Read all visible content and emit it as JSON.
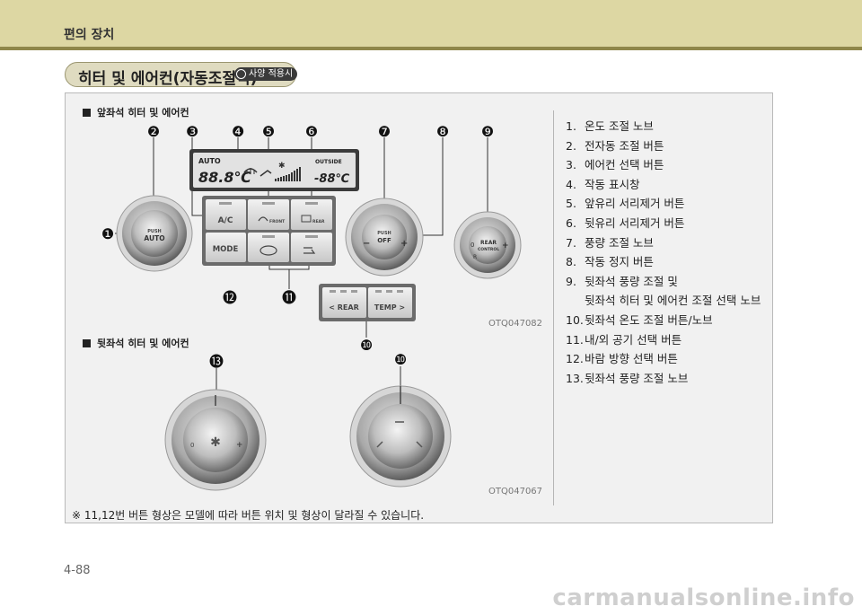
{
  "header": {
    "section_title": "편의 장치"
  },
  "title_pill": {
    "title": "히터 및 에어컨(자동조절식)",
    "badge": "사양 적용시"
  },
  "front": {
    "heading": "앞좌석 히터 및 에어컨",
    "image_code": "OTQ047082",
    "display": {
      "auto": "AUTO",
      "outside": "OUTSIDE",
      "temp": "88.8℃",
      "outside_temp": "-88℃"
    },
    "buttons": {
      "ac": "A/C",
      "front": "FRONT",
      "rear": "REAR",
      "mode": "MODE",
      "rear_ctrl": "< REAR",
      "temp_ctrl": "TEMP >"
    },
    "knobs": {
      "left_top": "PUSH",
      "left_bottom": "AUTO",
      "mid_top": "PUSH",
      "mid_bottom": "OFF",
      "right_line1": "REAR",
      "right_line2": "CONTROL",
      "right_zero": "0",
      "right_r": "R"
    }
  },
  "rear": {
    "heading": "뒷좌석 히터 및 에어컨",
    "image_code": "OTQ047067"
  },
  "callouts": [
    "❶",
    "❷",
    "❸",
    "❹",
    "❺",
    "❻",
    "❼",
    "❽",
    "❾",
    "❿",
    "⓫",
    "⓬",
    "⓭"
  ],
  "items": [
    {
      "num": "1.",
      "text": "온도 조절 노브"
    },
    {
      "num": "2.",
      "text": "전자동 조절 버튼"
    },
    {
      "num": "3.",
      "text": "에어컨 선택 버튼"
    },
    {
      "num": "4.",
      "text": "작동 표시창"
    },
    {
      "num": "5.",
      "text": "앞유리 서리제거 버튼"
    },
    {
      "num": "6.",
      "text": "뒷유리 서리제거 버튼"
    },
    {
      "num": "7.",
      "text": "풍량 조절 노브"
    },
    {
      "num": "8.",
      "text": "작동 정지 버튼"
    },
    {
      "num": "9.",
      "text": "뒷좌석 풍량 조절 및"
    },
    {
      "num": "",
      "text": "뒷좌석 히터 및 에어컨 조절 선택 노브"
    },
    {
      "num": "10.",
      "text": "뒷좌석 온도 조절 버튼/노브"
    },
    {
      "num": "11.",
      "text": "내/외 공기 선택 버튼"
    },
    {
      "num": "12.",
      "text": "바람 방향 선택 버튼"
    },
    {
      "num": "13.",
      "text": "뒷좌석 풍량 조절 노브"
    }
  ],
  "note": "※ 11,12번 버튼 형상은 모델에 따라 버튼 위치 및 형상이 달라질 수 있습니다.",
  "page_number": "4-88",
  "watermark": "carmanualsonline.info"
}
